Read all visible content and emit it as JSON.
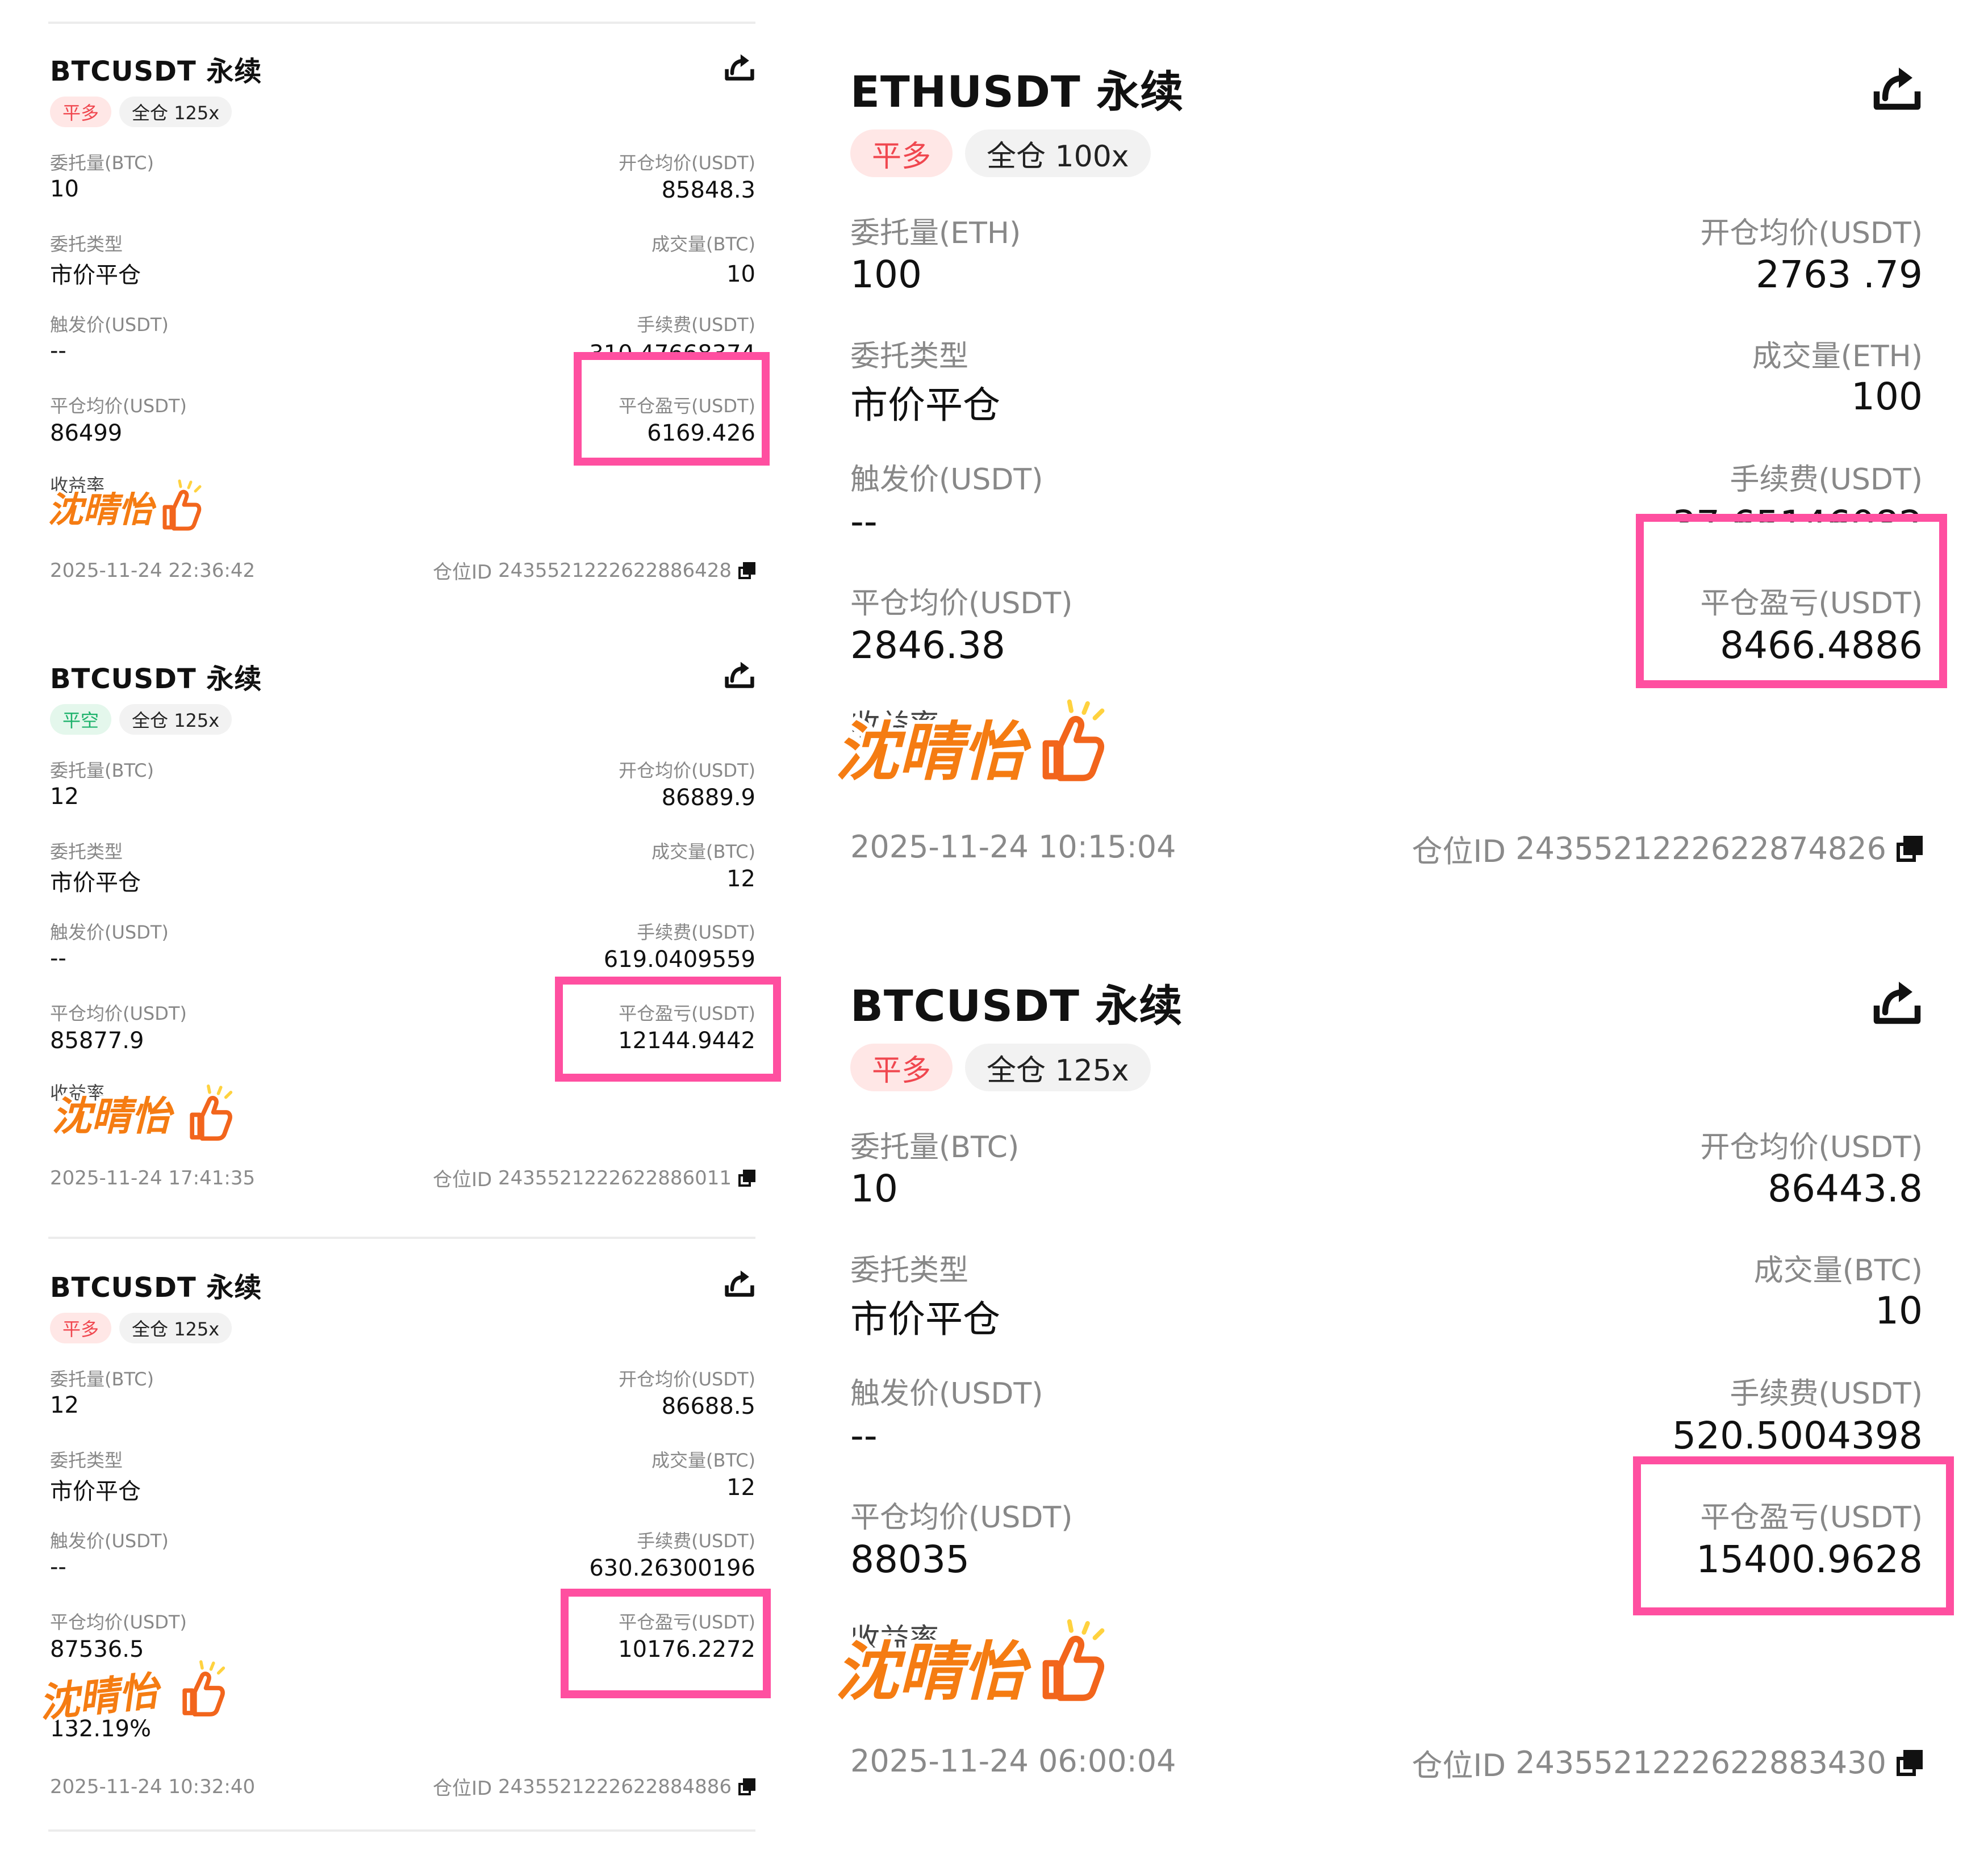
{
  "labels": {
    "order_qty_btc": "委托量(BTC)",
    "order_qty_eth": "委托量(ETH)",
    "avg_open": "开仓均价(USDT)",
    "order_type": "委托类型",
    "filled_btc": "成交量(BTC)",
    "filled_eth": "成交量(ETH)",
    "trigger_price": "触发价(USDT)",
    "fee": "手续费(USDT)",
    "avg_close": "平仓均价(USDT)",
    "close_pnl": "平仓盈亏(USDT)",
    "yield_rate": "收益率",
    "position_id_prefix": "仓位ID"
  },
  "watermark_text": "沈晴怡",
  "cards": [
    {
      "symbol": "BTCUSDT 永续",
      "side": "平多",
      "side_color": "#f0474f",
      "side_bg": "#ffe7e6",
      "margin": "全仓 125x",
      "order_qty": "10",
      "avg_open": "85848.3",
      "order_type": "市价平仓",
      "filled": "10",
      "trigger_price": "--",
      "fee": "310.47668374",
      "avg_close": "86499",
      "close_pnl": "6169.426",
      "timestamp": "2025-11-24 22:36:42",
      "position_id": "2435521222622886428"
    },
    {
      "symbol": "BTCUSDT 永续",
      "side": "平空",
      "side_color": "#1db26b",
      "side_bg": "#e4f7ec",
      "margin": "全仓 125x",
      "order_qty": "12",
      "avg_open": "86889.9",
      "order_type": "市价平仓",
      "filled": "12",
      "trigger_price": "--",
      "fee": "619.0409559",
      "avg_close": "85877.9",
      "close_pnl": "12144.9442",
      "timestamp": "2025-11-24 17:41:35",
      "position_id": "2435521222622886011"
    },
    {
      "symbol": "BTCUSDT 永续",
      "side": "平多",
      "side_color": "#f0474f",
      "side_bg": "#ffe7e6",
      "margin": "全仓 125x",
      "order_qty": "12",
      "avg_open": "86688.5",
      "order_type": "市价平仓",
      "filled": "12",
      "trigger_price": "--",
      "fee": "630.26300196",
      "avg_close": "87536.5",
      "close_pnl": "10176.2272",
      "yield_value": "132.19%",
      "timestamp": "2025-11-24 10:32:40",
      "position_id": "2435521222622884886"
    },
    {
      "symbol": "ETHUSDT 永续",
      "side": "平多",
      "side_color": "#f0474f",
      "side_bg": "#ffe7e6",
      "margin": "全仓 100x",
      "order_qty": "100",
      "avg_open": "2763 .79",
      "order_type": "市价平仓",
      "filled": "100",
      "trigger_price": "--",
      "fee": "37.65146082",
      "avg_close": "2846.38",
      "close_pnl": "8466.4886",
      "timestamp": "2025-11-24  10:15:04",
      "position_id": "2435521222622874826"
    },
    {
      "symbol": "BTCUSDT 永续",
      "side": "平多",
      "side_color": "#f0474f",
      "side_bg": "#ffe7e6",
      "margin": "全仓 125x",
      "order_qty": "10",
      "avg_open": "86443.8",
      "order_type": "市价平仓",
      "filled": "10",
      "trigger_price": "--",
      "fee": "520.5004398",
      "avg_close": "88035",
      "close_pnl": "15400.9628",
      "timestamp": "2025-11-24  06:00:04",
      "position_id": "2435521222622883430"
    }
  ],
  "icons": {
    "share": "share-icon",
    "copy": "copy-icon",
    "thumbs_up": "thumbs-up-icon"
  },
  "colors": {
    "highlight": "#ff4fa0",
    "label_gray": "#888888",
    "sticker_orange": "#f57c12",
    "sticker_yellow": "#ffd23f"
  }
}
